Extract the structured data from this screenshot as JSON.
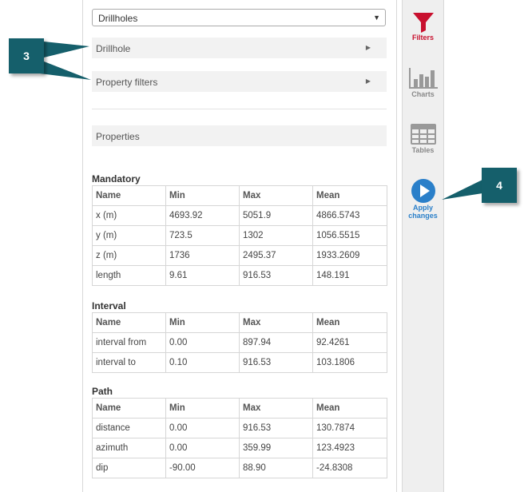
{
  "source_select": {
    "value": "Drillholes"
  },
  "sections": [
    {
      "label": "Drillhole"
    },
    {
      "label": "Property filters"
    },
    {
      "label": "Properties"
    }
  ],
  "headers": [
    "Name",
    "Min",
    "Max",
    "Mean"
  ],
  "groups": [
    {
      "title": "Mandatory",
      "rows": [
        [
          "x (m)",
          "4693.92",
          "5051.9",
          "4866.5743"
        ],
        [
          "y (m)",
          "723.5",
          "1302",
          "1056.5515"
        ],
        [
          "z (m)",
          "1736",
          "2495.37",
          "1933.2609"
        ],
        [
          "length",
          "9.61",
          "916.53",
          "148.191"
        ]
      ]
    },
    {
      "title": "Interval",
      "rows": [
        [
          "interval from",
          "0.00",
          "897.94",
          "92.4261"
        ],
        [
          "interval to",
          "0.10",
          "916.53",
          "103.1806"
        ]
      ]
    },
    {
      "title": "Path",
      "rows": [
        [
          "distance",
          "0.00",
          "916.53",
          "130.7874"
        ],
        [
          "azimuth",
          "0.00",
          "359.99",
          "123.4923"
        ],
        [
          "dip",
          "-90.00",
          "88.90",
          "-24.8308"
        ]
      ]
    }
  ],
  "sidebar": {
    "items": [
      {
        "label": "Filters",
        "icon": "funnel-icon",
        "color": "#c8102e"
      },
      {
        "label": "Charts",
        "icon": "bar-chart-icon",
        "color": "#888888"
      },
      {
        "label": "Tables",
        "icon": "table-icon",
        "color": "#888888"
      },
      {
        "label_line1": "Apply",
        "label_line2": "changes",
        "icon": "play-circle-icon",
        "color": "#2a7fc9"
      }
    ]
  },
  "callouts": [
    {
      "number": "3"
    },
    {
      "number": "4"
    }
  ]
}
